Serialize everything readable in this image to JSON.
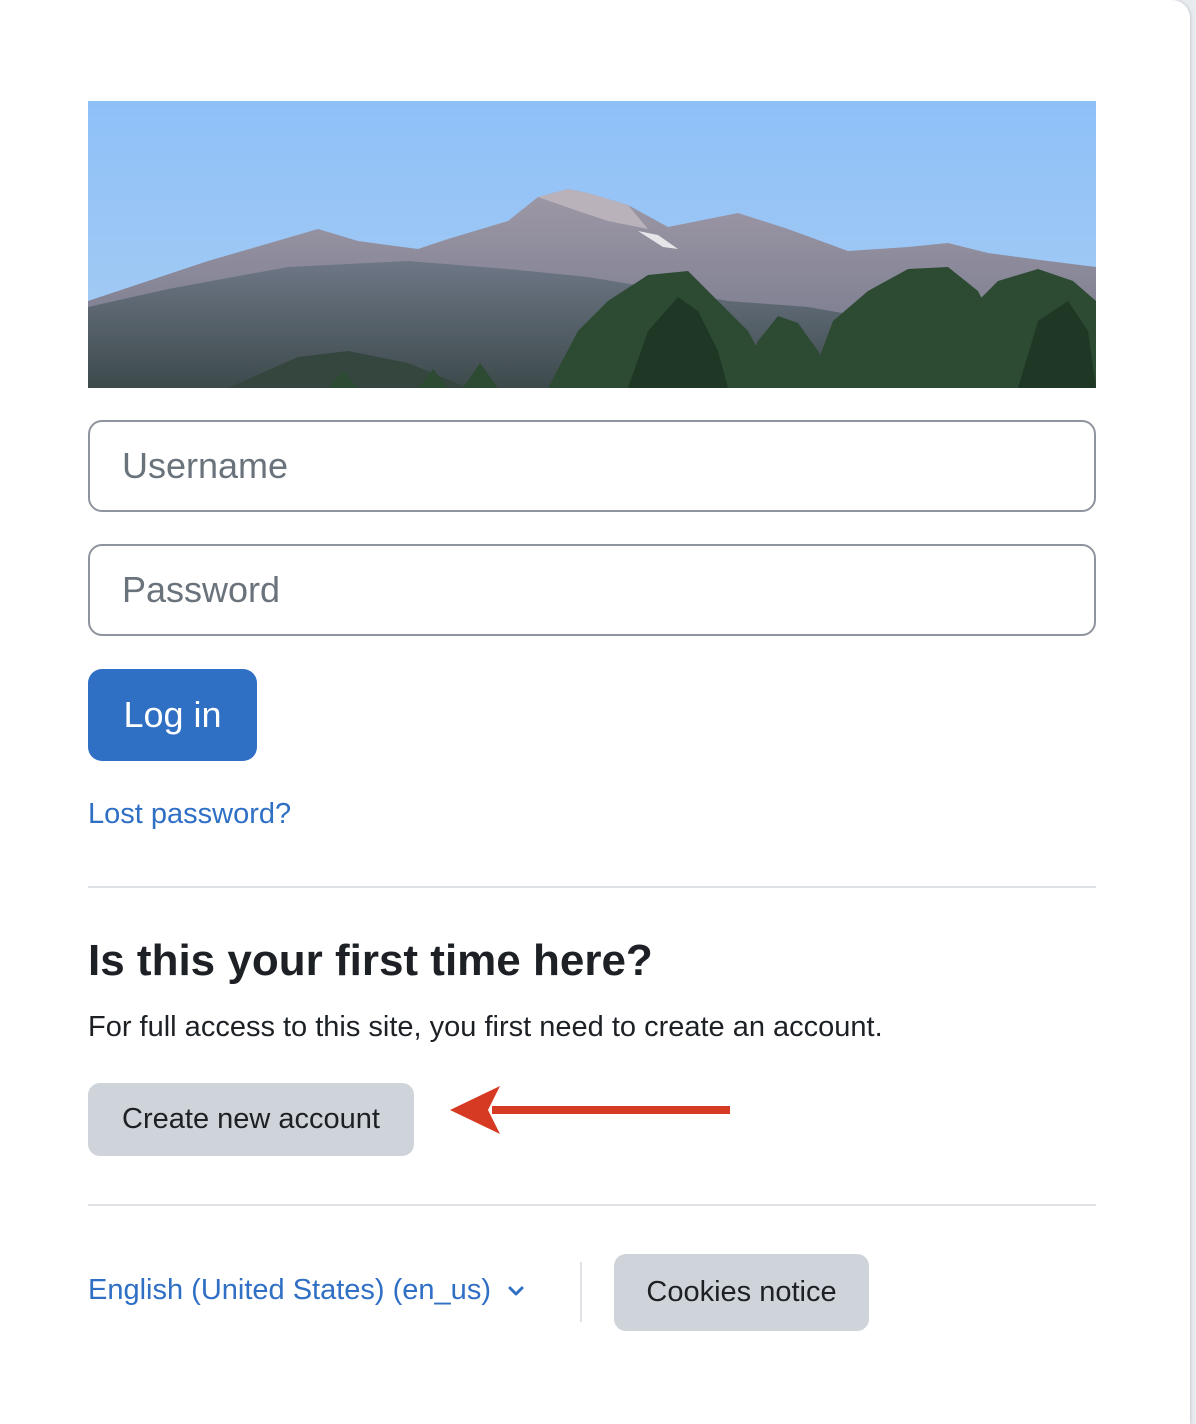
{
  "login": {
    "username_placeholder": "Username",
    "password_placeholder": "Password",
    "login_button": "Log in",
    "lost_password": "Lost password?"
  },
  "signup": {
    "heading": "Is this your first time here?",
    "text": "For full access to this site, you first need to create an account.",
    "create_button": "Create new account"
  },
  "footer": {
    "language": "English (United States) (en_us)",
    "cookies_button": "Cookies notice"
  },
  "colors": {
    "primary": "#2f6fc4",
    "secondary_button": "#ced4da",
    "annotation_arrow": "#d63a22"
  },
  "icons": {
    "banner": "mountain-banner-image",
    "language_dropdown": "chevron-down-icon",
    "annotation": "red-arrow-annotation"
  }
}
